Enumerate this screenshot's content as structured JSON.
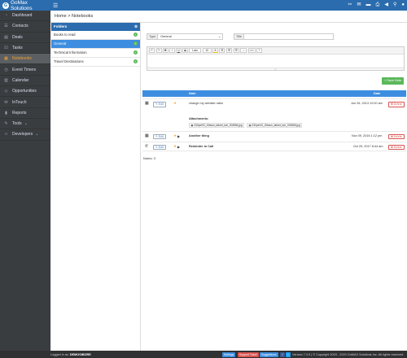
{
  "app": {
    "title": "GoMax Solutions",
    "logo_letter": "G"
  },
  "topbar": {
    "icons": [
      "tools-icon",
      "envelope-icon",
      "folder-icon",
      "print-icon",
      "megaphone-icon",
      "search-icon",
      "user-icon"
    ]
  },
  "sidebar": {
    "items": [
      {
        "label": "Dashboard",
        "icon": "gauge-icon",
        "glyph": "◔"
      },
      {
        "label": "Contacts",
        "icon": "contacts-icon",
        "glyph": "☰"
      },
      {
        "label": "Deals",
        "icon": "deals-icon",
        "glyph": "▤"
      },
      {
        "label": "Tasks",
        "icon": "tasks-icon",
        "glyph": "☑"
      },
      {
        "label": "Notebooks",
        "icon": "notebook-icon",
        "glyph": "▦",
        "active": true
      },
      {
        "label": "Event Timers",
        "icon": "timer-icon",
        "glyph": "◷"
      },
      {
        "label": "Calendar",
        "icon": "calendar-icon",
        "glyph": "▥"
      },
      {
        "label": "Opportunities",
        "icon": "diamond-icon",
        "glyph": "◇"
      },
      {
        "label": "InTouch",
        "icon": "envelope-icon",
        "glyph": "✉"
      },
      {
        "label": "Reports",
        "icon": "chart-icon",
        "glyph": "▮"
      },
      {
        "label": "Tools",
        "icon": "wrench-icon",
        "glyph": "✎",
        "caret": true
      },
      {
        "label": "Developers",
        "icon": "code-icon",
        "glyph": "‹›",
        "caret": true
      }
    ]
  },
  "breadcrumb": {
    "home": "Home",
    "sep": ">",
    "current": "Notebooks"
  },
  "folders": {
    "title": "Folders",
    "items": [
      {
        "label": "Books to read"
      },
      {
        "label": "General",
        "selected": true
      },
      {
        "label": "Technical Information"
      },
      {
        "label": "Travel Destinations"
      }
    ]
  },
  "filters": {
    "type_label": "Type",
    "type_value": "General",
    "title_label": "Title",
    "title_value": ""
  },
  "editor": {
    "tools": [
      "↶",
      "↷",
      "B",
      "I",
      "U",
      "S",
      "Lato",
      "10",
      "A",
      "☰",
      "☰",
      "☰",
      "⇔",
      "</>",
      "?"
    ]
  },
  "buttons": {
    "save": "Save Note",
    "edit": "Edit",
    "delete": "Delete"
  },
  "table": {
    "columns": {
      "note": "Note",
      "date": "Date"
    },
    "rows": [
      {
        "type_icon": "notebook-icon",
        "glyph": "▦",
        "star": "★",
        "expand": "",
        "note": "change my website rates",
        "date": "Jun 26, 2013 12:00 am",
        "attachments_label": "Attachments:",
        "attachments": [
          "230pxHO_Gibson_tabret_tutr_003556.jpg",
          "230pxHO_Gibson_tabret_tutr_003556.jpg"
        ]
      },
      {
        "type_icon": "notebook-icon",
        "glyph": "▦",
        "star": "★",
        "expand": "▶",
        "note": "Another thing",
        "date": "Nov 09, 2016 1:12 pm"
      },
      {
        "type_icon": "phone-icon",
        "glyph": "✆",
        "star": "★",
        "expand": "▶",
        "note": "Reminder to Call",
        "date": "Oct 29, 2017 8:44 am"
      }
    ]
  },
  "notes_count": "Notes: 3",
  "footer": {
    "logged_in": "Logged in as:",
    "user": "DEMOSIBORE",
    "settings": "Settings",
    "support": "Support Ticket",
    "suggestions": "Suggestions",
    "copyright": "Version 7.3.9 | © Copyright 2003 - 2020 GoMAX Solutions Inc. All rights reserved."
  },
  "colors": {
    "brand": "#2a6cae",
    "accent": "#3d8ee0",
    "active_item": "#f0a030",
    "success": "#5cb85c",
    "danger": "#d9534f"
  }
}
